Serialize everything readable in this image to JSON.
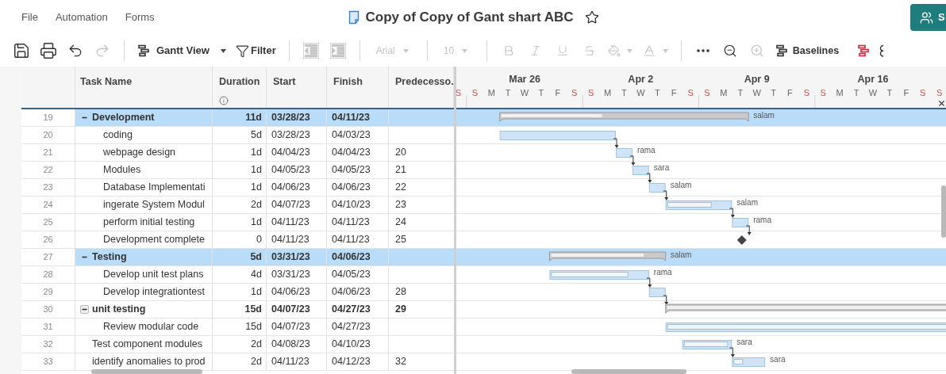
{
  "menu": [
    {
      "label": "File"
    },
    {
      "label": "Automation"
    },
    {
      "label": "Forms"
    }
  ],
  "sheet_title": "Copy of Copy of Gant shart ABC",
  "favorite": false,
  "share_button": {
    "label": "S"
  },
  "toolbar": [
    {
      "kind": "save",
      "disabled": false
    },
    {
      "kind": "print",
      "disabled": false
    },
    {
      "kind": "undo",
      "disabled": false
    },
    {
      "kind": "redo",
      "disabled": true
    },
    {
      "kind": "divider"
    },
    {
      "kind": "view",
      "label": "Gantt View",
      "disabled": false
    },
    {
      "kind": "filter",
      "label": "Filter",
      "disabled": false
    },
    {
      "kind": "divider"
    },
    {
      "kind": "outdent",
      "disabled": true
    },
    {
      "kind": "indent",
      "disabled": true
    },
    {
      "kind": "divider"
    },
    {
      "kind": "font",
      "label": "Arial",
      "disabled": true
    },
    {
      "kind": "divider"
    },
    {
      "kind": "size",
      "label": "10",
      "disabled": true
    },
    {
      "kind": "divider"
    },
    {
      "kind": "bold",
      "disabled": true
    },
    {
      "kind": "italic",
      "disabled": true
    },
    {
      "kind": "underline",
      "disabled": true
    },
    {
      "kind": "strike",
      "disabled": true
    },
    {
      "kind": "fill",
      "disabled": true
    },
    {
      "kind": "color",
      "disabled": true
    },
    {
      "kind": "divider"
    },
    {
      "kind": "more",
      "disabled": false
    },
    {
      "kind": "zoomout",
      "disabled": false
    },
    {
      "kind": "zoomin",
      "disabled": true
    },
    {
      "kind": "baselines",
      "label": "Baselines",
      "disabled": false
    },
    {
      "kind": "critical",
      "disabled": false
    },
    {
      "kind": "partial",
      "disabled": false
    }
  ],
  "columns": [
    {
      "label": "Task Name"
    },
    {
      "label": "Duration",
      "info": true
    },
    {
      "label": "Start"
    },
    {
      "label": "Finish"
    },
    {
      "label": "Predecesso."
    }
  ],
  "timeline": {
    "weeks": [
      "Mar 26",
      "Apr 2",
      "Apr 9",
      "Apr 16"
    ],
    "days": [
      {
        "label": "S",
        "weekend": true
      },
      {
        "label": "S",
        "weekend": true
      },
      {
        "label": "M",
        "weekend": false
      },
      {
        "label": "T",
        "weekend": false
      },
      {
        "label": "W",
        "weekend": false
      },
      {
        "label": "T",
        "weekend": false
      },
      {
        "label": "F",
        "weekend": false
      },
      {
        "label": "S",
        "weekend": true
      },
      {
        "label": "S",
        "weekend": true
      },
      {
        "label": "M",
        "weekend": false
      },
      {
        "label": "T",
        "weekend": false
      },
      {
        "label": "W",
        "weekend": false
      },
      {
        "label": "T",
        "weekend": false
      },
      {
        "label": "F",
        "weekend": false
      },
      {
        "label": "S",
        "weekend": true
      },
      {
        "label": "S",
        "weekend": true
      },
      {
        "label": "M",
        "weekend": false
      },
      {
        "label": "T",
        "weekend": false
      },
      {
        "label": "W",
        "weekend": false
      },
      {
        "label": "T",
        "weekend": false
      },
      {
        "label": "F",
        "weekend": false
      },
      {
        "label": "S",
        "weekend": true
      },
      {
        "label": "S",
        "weekend": true
      },
      {
        "label": "M",
        "weekend": false
      },
      {
        "label": "T",
        "weekend": false
      },
      {
        "label": "W",
        "weekend": false
      },
      {
        "label": "T",
        "weekend": false
      },
      {
        "label": "F",
        "weekend": false
      },
      {
        "label": "S",
        "weekend": true
      },
      {
        "label": "S",
        "weekend": true
      }
    ]
  },
  "tasks": [
    {
      "number": "19",
      "name": "Development",
      "kind": "summary",
      "expanded": true,
      "selected": true,
      "duration": "11d",
      "start": "03/28/23",
      "finish": "04/11/23",
      "level": 0.41,
      "resource": "salam",
      "children": [
        {
          "number": "20",
          "name": "coding",
          "kind": "task",
          "selected": false,
          "duration": "5d",
          "start": "03/28/23",
          "finish": "04/03/23"
        },
        {
          "number": "21",
          "name": "webpage design",
          "kind": "task",
          "selected": false,
          "duration": "1d",
          "start": "04/04/23",
          "finish": "04/04/23",
          "predecessors": "20",
          "resource": "rama"
        },
        {
          "number": "22",
          "name": "Modules",
          "kind": "task",
          "selected": false,
          "duration": "1d",
          "start": "04/05/23",
          "finish": "04/05/23",
          "predecessors": "21",
          "resource": "sara"
        },
        {
          "number": "23",
          "name": "Database Implementati",
          "kind": "task",
          "selected": false,
          "duration": "1d",
          "start": "04/06/23",
          "finish": "04/06/23",
          "predecessors": "22",
          "resource": "salam"
        },
        {
          "number": "24",
          "name": "ingerate System Modul",
          "kind": "task",
          "selected": false,
          "duration": "2d",
          "start": "04/07/23",
          "finish": "04/10/23",
          "predecessors": "23",
          "level": 0.7,
          "resource": "salam"
        },
        {
          "number": "25",
          "name": "perform initial testing",
          "kind": "task",
          "selected": false,
          "duration": "1d",
          "start": "04/11/23",
          "finish": "04/11/23",
          "predecessors": "24",
          "resource": "rama"
        },
        {
          "number": "26",
          "name": "Development complete",
          "kind": "milestone",
          "selected": false,
          "duration": "0",
          "start": "04/11/23",
          "finish": "04/11/23",
          "predecessors": "25"
        }
      ]
    },
    {
      "number": "27",
      "name": "Testing",
      "kind": "summary",
      "expanded": true,
      "selected": true,
      "duration": "5d",
      "start": "03/31/23",
      "finish": "04/06/23",
      "level": 0.82,
      "resource": "salam",
      "children": [
        {
          "number": "28",
          "name": "Develop unit test plans",
          "kind": "task",
          "selected": false,
          "duration": "4d",
          "start": "03/31/23",
          "finish": "04/05/23",
          "level": 0.8,
          "resource": "rama"
        },
        {
          "number": "29",
          "name": "Develop integrationtest",
          "kind": "task",
          "selected": false,
          "duration": "1d",
          "start": "04/06/23",
          "finish": "04/06/23",
          "predecessors": "28"
        }
      ]
    },
    {
      "number": "30",
      "name": "unit testing",
      "kind": "summary",
      "expanded": true,
      "selected": false,
      "duration": "15d",
      "start": "04/07/23",
      "finish": "04/27/23",
      "predecessors": "29",
      "level": 1,
      "children": [
        {
          "number": "31",
          "name": "Review modular code",
          "kind": "task",
          "selected": false,
          "duration": "15d",
          "start": "04/07/23",
          "finish": "04/27/23",
          "level": 1
        }
      ]
    },
    {
      "number": "32",
      "name": "Test component modules",
      "kind": "task",
      "selected": false,
      "duration": "2d",
      "start": "04/08/23",
      "finish": "04/10/23",
      "level": 0.95,
      "resource": "sara"
    },
    {
      "number": "33",
      "name": "identify anomalies to prod",
      "kind": "task",
      "selected": false,
      "duration": "2d",
      "start": "04/11/23",
      "finish": "04/12/23",
      "predecessors": "32",
      "level": 0.3,
      "resource": "sara"
    }
  ]
}
